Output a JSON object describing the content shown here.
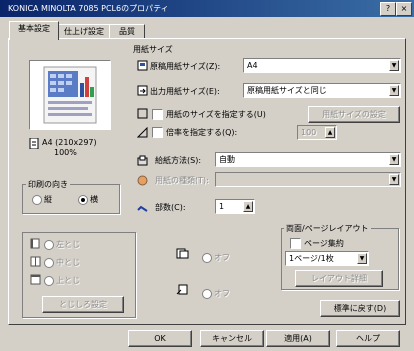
{
  "window": {
    "title": "KONICA MINOLTA 7085 PCL6のプロパティ",
    "help_glyph": "?",
    "close_glyph": "×"
  },
  "tabs": [
    {
      "label": "基本設定"
    },
    {
      "label": "仕上げ設定"
    },
    {
      "label": "品質"
    }
  ],
  "preview": {
    "caption_line1": "A4 (210x297)",
    "caption_line2": "100%"
  },
  "orientation": {
    "group_label": "印刷の向き",
    "options": [
      {
        "label": "縦"
      },
      {
        "label": "横"
      }
    ],
    "selected_index": 1
  },
  "paper": {
    "group_label": "用紙サイズ",
    "original_size_label": "原稿用紙サイズ(Z):",
    "original_size_value": "A4",
    "output_size_label": "出力用紙サイズ(E):",
    "output_size_value": "原稿用紙サイズと同じ",
    "custom_size_label": "用紙のサイズを指定する(U)",
    "custom_size_button": "用紙サイズの設定",
    "zoom_label": "倍率を指定する(Q):",
    "zoom_value": "100",
    "source_label": "給紙方法(S):",
    "source_value": "自動",
    "type_label": "用紙の種類(T):",
    "type_value": "",
    "copies_label": "部数(C):",
    "copies_value": "1"
  },
  "layout": {
    "group_label": "両面/ページレイアウト",
    "duplex_label": "ページ集約",
    "pages_value": "1ページ/1枚",
    "detail_button": "レイアウト詳細",
    "default_button": "標準に戻す(D)"
  },
  "disabled_section": {
    "items": [
      {
        "label": "左とじ"
      },
      {
        "label": "中とじ"
      },
      {
        "label": "上とじ"
      }
    ],
    "button": "とじしろ設定",
    "mid_items": [
      {
        "label": "オフ"
      },
      {
        "label": "オフ"
      }
    ]
  },
  "footer": {
    "ok": "OK",
    "cancel": "キャンセル",
    "apply": "適用(A)",
    "help": "ヘルプ"
  }
}
